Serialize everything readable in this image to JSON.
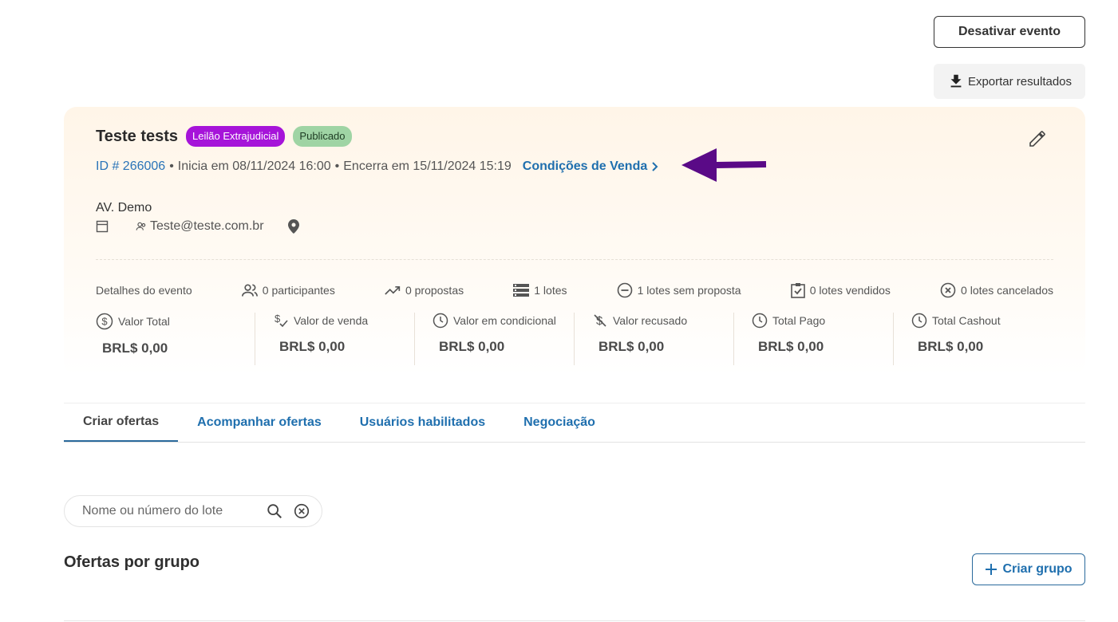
{
  "header": {
    "deactivate_label": "Desativar evento",
    "export_label": "Exportar resultados"
  },
  "event": {
    "title": "Teste tests",
    "badges": [
      "Leilão Extrajudicial",
      "Publicado"
    ],
    "id_text": "ID # 266006",
    "start_text": "Inicia em 08/11/2024 16:00",
    "end_text": "Encerra em 15/11/2024 15:19",
    "conditions_label": "Condições de Venda",
    "venue": "AV. Demo",
    "contact": "Teste@teste.com.br"
  },
  "stats": {
    "details_label": "Detalhes do evento",
    "participants": "0 participantes",
    "proposals": "0 propostas",
    "lots": "1 lotes",
    "lots_no_proposal": "1 lotes sem proposta",
    "lots_sold": "0 lotes vendidos",
    "lots_cancelled": "0 lotes cancelados"
  },
  "values": [
    {
      "label": "Valor Total",
      "amount": "BRL$ 0,00"
    },
    {
      "label": "Valor de venda",
      "amount": "BRL$ 0,00"
    },
    {
      "label": "Valor em condicional",
      "amount": "BRL$ 0,00"
    },
    {
      "label": "Valor recusado",
      "amount": "BRL$ 0,00"
    },
    {
      "label": "Total Pago",
      "amount": "BRL$ 0,00"
    },
    {
      "label": "Total Cashout",
      "amount": "BRL$ 0,00"
    }
  ],
  "tabs": [
    "Criar ofertas",
    "Acompanhar ofertas",
    "Usuários habilitados",
    "Negociação"
  ],
  "search": {
    "placeholder": "Nome ou número do lote"
  },
  "section": {
    "title": "Ofertas por grupo",
    "create_group_label": "Criar grupo"
  },
  "colors": {
    "accent_blue": "#1f6fae",
    "badge_purple": "#a614d9",
    "badge_green": "#9fd4a4",
    "arrow_purple": "#5a0a87"
  }
}
